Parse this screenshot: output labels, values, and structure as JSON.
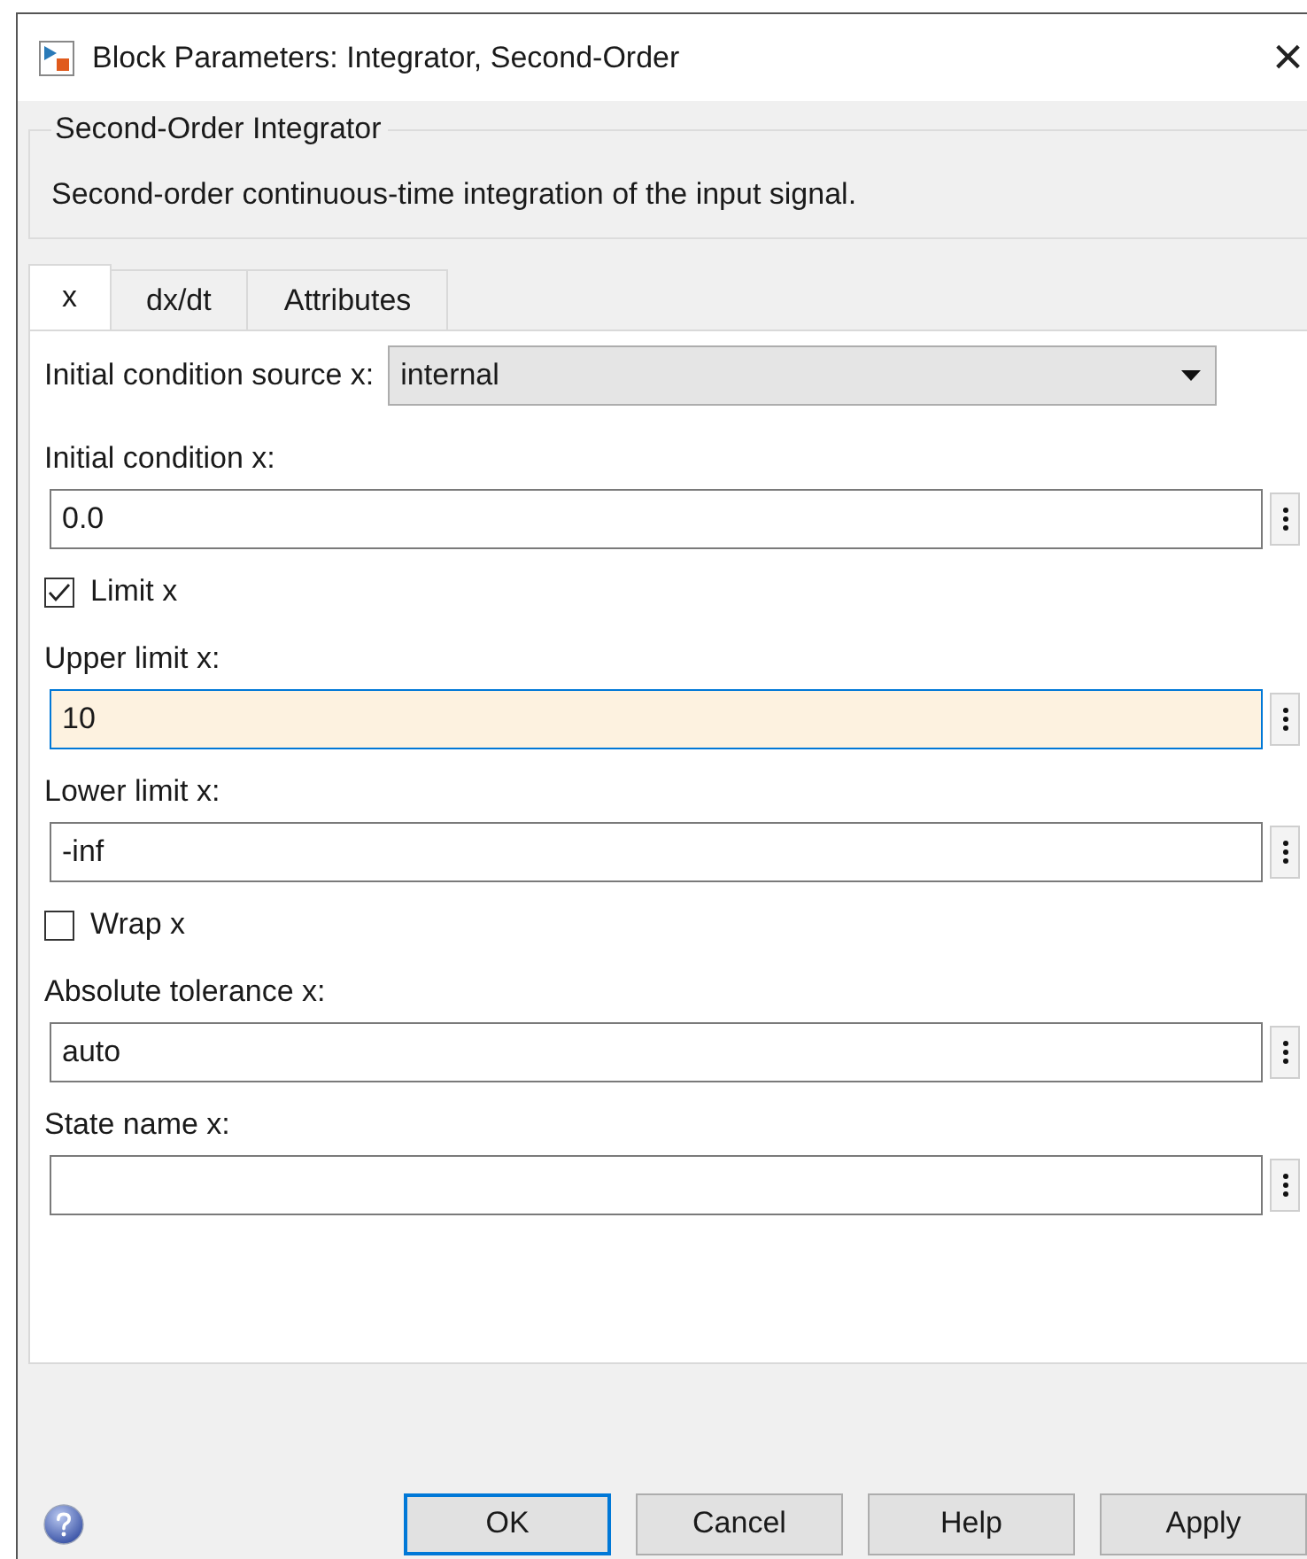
{
  "window": {
    "title": "Block Parameters: Integrator, Second-Order",
    "close": "×"
  },
  "group": {
    "title": "Second-Order Integrator",
    "description": "Second-order continuous-time integration of the input signal."
  },
  "tabs": [
    {
      "label": "x",
      "selected": true
    },
    {
      "label": "dx/dt",
      "selected": false
    },
    {
      "label": "Attributes",
      "selected": false
    }
  ],
  "params": [
    {
      "kind": "dropdown",
      "label": "Initial condition source x:",
      "value": "internal"
    },
    {
      "kind": "field",
      "label": "Initial condition x:",
      "value": "0.0",
      "focused": false
    },
    {
      "kind": "checkbox",
      "label": "Limit x",
      "checked": true
    },
    {
      "kind": "field",
      "label": "Upper limit x:",
      "value": "10",
      "focused": true
    },
    {
      "kind": "field",
      "label": "Lower limit x:",
      "value": "-inf",
      "focused": false
    },
    {
      "kind": "checkbox",
      "label": "Wrap x",
      "checked": false
    },
    {
      "kind": "field",
      "label": "Absolute tolerance x:",
      "value": "auto",
      "focused": false
    },
    {
      "kind": "field",
      "label": "State name x:",
      "focused": false
    }
  ],
  "buttons": [
    {
      "label": "OK",
      "default": true
    },
    {
      "label": "Cancel",
      "default": false
    },
    {
      "label": "Help",
      "default": false
    },
    {
      "label": "Apply",
      "default": false
    }
  ]
}
